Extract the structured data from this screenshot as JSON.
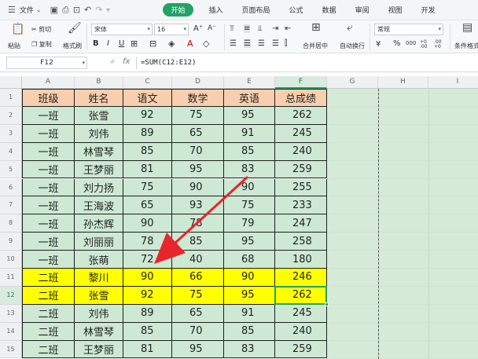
{
  "menubar": {
    "file_label": "文件",
    "tabs": [
      "开始",
      "插入",
      "页面布局",
      "公式",
      "数据",
      "审阅",
      "视图",
      "开发"
    ],
    "active_tab": "开始"
  },
  "ribbon": {
    "paste": "粘贴",
    "cut": "剪切",
    "copy": "复制",
    "format_painter": "格式刷",
    "font_name": "宋体",
    "font_size": "16",
    "grow_font": "A⁺",
    "shrink_font": "A⁻",
    "bold": "B",
    "italic": "I",
    "underline": "U",
    "merge_center": "合并居中",
    "wrap_text": "自动换行",
    "number_format": "常规",
    "percent": "%",
    "thousands": "000",
    "inc_decimal": "+0 .00",
    "dec_decimal": ".00 +0",
    "conditional_format": "条件格式"
  },
  "formula_bar": {
    "cell_ref": "F12",
    "fx": "fx",
    "formula": "=SUM(C12:E12)"
  },
  "columns": [
    "A",
    "B",
    "C",
    "D",
    "E",
    "F",
    "G",
    "H",
    "I"
  ],
  "selected_column": "F",
  "row_numbers": [
    "1",
    "2",
    "3",
    "4",
    "5",
    "6",
    "7",
    "8",
    "9",
    "10",
    "11",
    "12",
    "13",
    "14",
    "15"
  ],
  "selected_row": "12",
  "table": {
    "headers": [
      "班级",
      "姓名",
      "语文",
      "数学",
      "英语",
      "总成绩"
    ],
    "rows": [
      [
        "一班",
        "张雪",
        "92",
        "75",
        "95",
        "262"
      ],
      [
        "一班",
        "刘伟",
        "89",
        "65",
        "91",
        "245"
      ],
      [
        "一班",
        "林雪琴",
        "85",
        "70",
        "85",
        "240"
      ],
      [
        "一班",
        "王梦丽",
        "81",
        "95",
        "83",
        "259"
      ],
      [
        "一班",
        "刘力扬",
        "75",
        "90",
        "90",
        "255"
      ],
      [
        "一班",
        "王海波",
        "65",
        "93",
        "75",
        "233"
      ],
      [
        "一班",
        "孙杰辉",
        "90",
        "78",
        "79",
        "247"
      ],
      [
        "一班",
        "刘丽丽",
        "78",
        "85",
        "95",
        "258"
      ],
      [
        "一班",
        "张萌",
        "72",
        "40",
        "68",
        "180"
      ],
      [
        "二班",
        "黎川",
        "90",
        "66",
        "90",
        "246"
      ],
      [
        "二班",
        "张雪",
        "92",
        "75",
        "95",
        "262"
      ],
      [
        "二班",
        "刘伟",
        "89",
        "65",
        "91",
        "245"
      ],
      [
        "二班",
        "林雪琴",
        "85",
        "70",
        "85",
        "240"
      ],
      [
        "二班",
        "王梦丽",
        "81",
        "95",
        "83",
        "259"
      ]
    ],
    "highlighted_rows": [
      10,
      11
    ]
  },
  "colors": {
    "accent": "#21a366",
    "header_fill": "#f8cfae",
    "row_fill": "#cde8d3",
    "highlight_fill": "#ffff00",
    "arrow": "#e8252b"
  }
}
